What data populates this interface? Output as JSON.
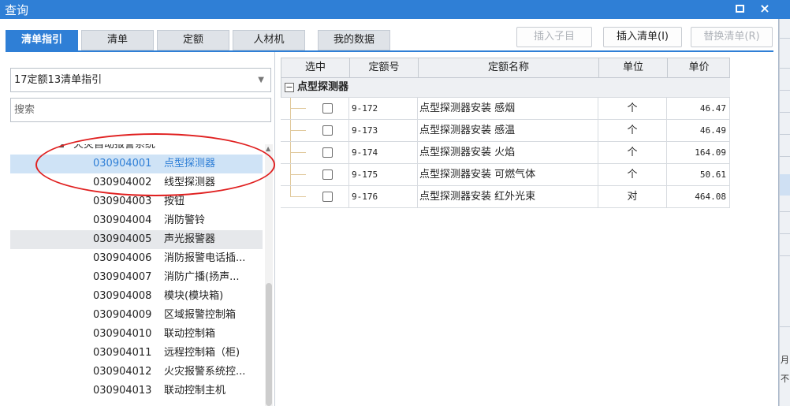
{
  "window": {
    "title": "查询",
    "maximize_icon": "maximize-icon",
    "close_label": "×"
  },
  "tabs": [
    {
      "label": "清单指引",
      "active": true
    },
    {
      "label": "清单",
      "active": false
    },
    {
      "label": "定额",
      "active": false
    },
    {
      "label": "人材机",
      "active": false
    },
    {
      "label": "我的数据",
      "active": false
    }
  ],
  "toolbar": {
    "insert_child": "插入子目",
    "insert_list": "插入清单(I)",
    "replace_list": "替换清单(R)"
  },
  "left": {
    "selected_guide": "17定额13清单指引",
    "search_placeholder": "搜索",
    "tree_parent": "火灾自动报警系统",
    "tree_items": [
      {
        "code": "030904001",
        "name": "点型探测器"
      },
      {
        "code": "030904002",
        "name": "线型探测器"
      },
      {
        "code": "030904003",
        "name": "按钮"
      },
      {
        "code": "030904004",
        "name": "消防警铃"
      },
      {
        "code": "030904005",
        "name": "声光报警器"
      },
      {
        "code": "030904006",
        "name": "消防报警电话插..."
      },
      {
        "code": "030904007",
        "name": "消防广播(扬声..."
      },
      {
        "code": "030904008",
        "name": "模块(模块箱)"
      },
      {
        "code": "030904009",
        "name": "区域报警控制箱"
      },
      {
        "code": "030904010",
        "name": "联动控制箱"
      },
      {
        "code": "030904011",
        "name": "远程控制箱（柜)"
      },
      {
        "code": "030904012",
        "name": "火灾报警系统控..."
      },
      {
        "code": "030904013",
        "name": "联动控制主机"
      }
    ]
  },
  "grid": {
    "headers": {
      "select": "选中",
      "code": "定额号",
      "name": "定额名称",
      "unit": "单位",
      "price": "单价"
    },
    "group_label": "点型探测器",
    "group_toggle": "−",
    "rows": [
      {
        "code": "9-172",
        "name": "点型探测器安装 感烟",
        "unit": "个",
        "price": "46.47"
      },
      {
        "code": "9-173",
        "name": "点型探测器安装 感温",
        "unit": "个",
        "price": "46.49"
      },
      {
        "code": "9-174",
        "name": "点型探测器安装 火焰",
        "unit": "个",
        "price": "164.09"
      },
      {
        "code": "9-175",
        "name": "点型探测器安装 可燃气体",
        "unit": "个",
        "price": "50.61"
      },
      {
        "code": "9-176",
        "name": "点型探测器安装 红外光束",
        "unit": "对",
        "price": "464.08"
      }
    ]
  },
  "side": {
    "text1": "月",
    "text2": "不"
  },
  "colors": {
    "accent": "#2f7fd6",
    "highlight_circle": "#e02020"
  }
}
